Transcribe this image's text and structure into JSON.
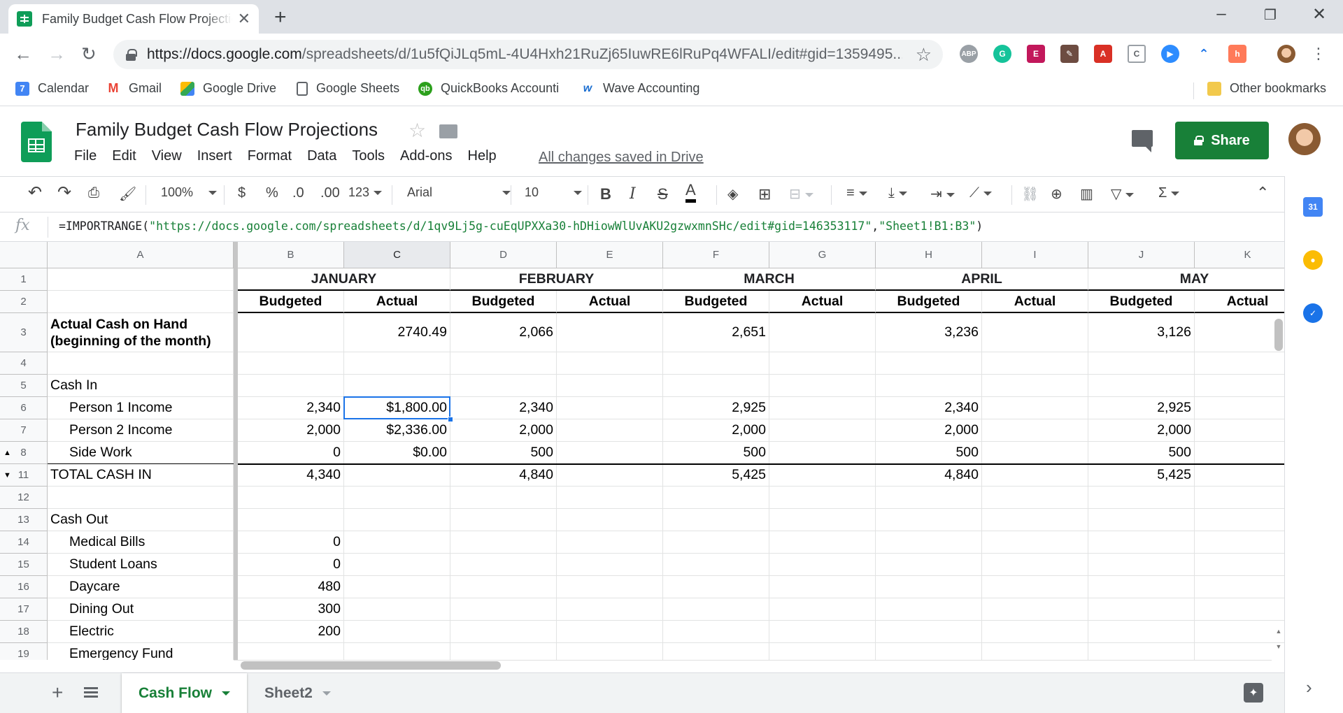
{
  "browser": {
    "tab_title": "Family Budget Cash Flow Projections",
    "url_domain": "https://docs.google.com",
    "url_path": "/spreadsheets/d/1u5fQiJLq5mL-4U4Hxh21RuZj65IuwRE6lRuPq4WFALI/edit#gid=1359495..."
  },
  "bookmarks": [
    {
      "label": "Calendar",
      "icon": "calendar-icon",
      "color": "#4285f4"
    },
    {
      "label": "Gmail",
      "icon": "gmail-icon",
      "color": "#ea4335"
    },
    {
      "label": "Google Drive",
      "icon": "drive-icon",
      "color": "#fbbc04"
    },
    {
      "label": "Google Sheets",
      "icon": "page-icon",
      "color": "#5f6368"
    },
    {
      "label": "QuickBooks Accounti",
      "icon": "quickbooks-icon",
      "color": "#2ca01c"
    },
    {
      "label": "Wave Accounting",
      "icon": "wave-icon",
      "color": "#1c6fd1"
    }
  ],
  "other_bookmarks": "Other bookmarks",
  "doc": {
    "title": "Family Budget Cash Flow Projections",
    "menu": [
      "File",
      "Edit",
      "View",
      "Insert",
      "Format",
      "Data",
      "Tools",
      "Add-ons",
      "Help"
    ],
    "saved_status": "All changes saved in Drive",
    "share_label": "Share"
  },
  "toolbar": {
    "zoom": "100%",
    "currency": "$",
    "percent": "%",
    "dec_less": ".0",
    "dec_more": ".00",
    "more_formats": "123",
    "font": "Arial",
    "font_size": "10"
  },
  "formula": {
    "prefix": "=IMPORTRANGE(",
    "arg1": "\"https://docs.google.com/spreadsheets/d/1qv9Lj5g-cuEqUPXXa30-hDHiowWlUvAKU2gzwxmnSHc/edit#gid=146353117\"",
    "sep": ",",
    "arg2": "\"Sheet1!B1:B3\"",
    "suffix": ")"
  },
  "columns": [
    "A",
    "B",
    "C",
    "D",
    "E",
    "F",
    "G",
    "H",
    "I",
    "J",
    "K"
  ],
  "month_headers": [
    "JANUARY",
    "FEBRUARY",
    "MARCH",
    "APRIL",
    "MAY"
  ],
  "subheaders": [
    "Budgeted",
    "Actual"
  ],
  "rows": [
    {
      "num": "1",
      "cells": []
    },
    {
      "num": "2",
      "cells": []
    },
    {
      "num": "3",
      "label": "Actual Cash on Hand (beginning of the month)",
      "bold": true,
      "cells": [
        "",
        "2740.49",
        "2,066",
        "",
        "2,651",
        "",
        "3,236",
        "",
        "3,126",
        ""
      ]
    },
    {
      "num": "4",
      "label": "",
      "cells": [
        "",
        "",
        "",
        "",
        "",
        "",
        "",
        "",
        "",
        ""
      ]
    },
    {
      "num": "5",
      "label": "Cash In",
      "cells": [
        "",
        "",
        "",
        "",
        "",
        "",
        "",
        "",
        "",
        ""
      ]
    },
    {
      "num": "6",
      "label": "Person 1 Income",
      "indent": true,
      "cells": [
        "2,340",
        "$1,800.00",
        "2,340",
        "",
        "2,925",
        "",
        "2,340",
        "",
        "2,925",
        ""
      ]
    },
    {
      "num": "7",
      "label": "Person 2 Income",
      "indent": true,
      "cells": [
        "2,000",
        "$2,336.00",
        "2,000",
        "",
        "2,000",
        "",
        "2,000",
        "",
        "2,000",
        ""
      ]
    },
    {
      "num": "8",
      "label": "Side Work",
      "indent": true,
      "cells": [
        "0",
        "$0.00",
        "500",
        "",
        "500",
        "",
        "500",
        "",
        "500",
        ""
      ]
    },
    {
      "num": "11",
      "label": "TOTAL CASH IN",
      "cells": [
        "4,340",
        "",
        "4,840",
        "",
        "5,425",
        "",
        "4,840",
        "",
        "5,425",
        ""
      ]
    },
    {
      "num": "12",
      "label": "",
      "cells": [
        "",
        "",
        "",
        "",
        "",
        "",
        "",
        "",
        "",
        ""
      ]
    },
    {
      "num": "13",
      "label": "Cash Out",
      "cells": [
        "",
        "",
        "",
        "",
        "",
        "",
        "",
        "",
        "",
        ""
      ]
    },
    {
      "num": "14",
      "label": "Medical Bills",
      "indent": true,
      "cells": [
        "0",
        "",
        "",
        "",
        "",
        "",
        "",
        "",
        "",
        ""
      ]
    },
    {
      "num": "15",
      "label": "Student Loans",
      "indent": true,
      "cells": [
        "0",
        "",
        "",
        "",
        "",
        "",
        "",
        "",
        "",
        ""
      ]
    },
    {
      "num": "16",
      "label": "Daycare",
      "indent": true,
      "cells": [
        "480",
        "",
        "",
        "",
        "",
        "",
        "",
        "",
        "",
        ""
      ]
    },
    {
      "num": "17",
      "label": "Dining Out",
      "indent": true,
      "cells": [
        "300",
        "",
        "",
        "",
        "",
        "",
        "",
        "",
        "",
        ""
      ]
    },
    {
      "num": "18",
      "label": "Electric",
      "indent": true,
      "cells": [
        "200",
        "",
        "",
        "",
        "",
        "",
        "",
        "",
        "",
        ""
      ]
    },
    {
      "num": "19",
      "label": "Emergency Fund",
      "indent": true,
      "cells": [
        "",
        "",
        "",
        "",
        "",
        "",
        "",
        "",
        "",
        ""
      ]
    }
  ],
  "sheets": [
    "Cash Flow",
    "Sheet2"
  ],
  "active_sheet": "Cash Flow"
}
